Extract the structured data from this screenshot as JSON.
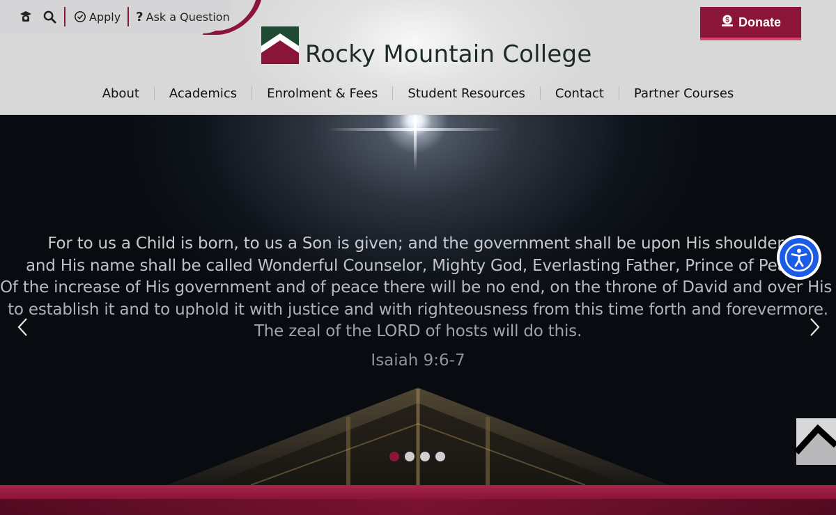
{
  "header": {
    "utility": {
      "apply_label": "Apply",
      "ask_label": "Ask a Question"
    },
    "donate_label": "Donate",
    "logo_text": "Rocky Mountain College"
  },
  "nav": {
    "items": [
      {
        "label": "About"
      },
      {
        "label": "Academics"
      },
      {
        "label": "Enrolment & Fees"
      },
      {
        "label": "Student Resources"
      },
      {
        "label": "Contact"
      },
      {
        "label": "Partner Courses"
      }
    ]
  },
  "hero": {
    "verse_lines": [
      "For to us a Child is born, to us a Son is given; and the government shall be upon His shoulder,",
      "and His name shall be called Wonderful Counselor, Mighty God, Everlasting Father, Prince of Peace.",
      "Of the increase of His government and of peace there will be no end, on the throne of David and over His kingdom,",
      "to establish it and to uphold it with justice and with righteousness from this time forth and forevermore.",
      "The zeal of the LORD of hosts will do this."
    ],
    "citation": "Isaiah 9:6-7",
    "slides_total": 4,
    "active_slide": 1
  },
  "colors": {
    "brand_maroon": "#8a1538",
    "brand_green": "#1f4a33",
    "accessibility_blue": "#1b5ce6"
  },
  "icons": [
    "graduate-icon",
    "search-icon",
    "check-circle-icon",
    "question-icon",
    "donate-hand-icon",
    "chevron-left-icon",
    "chevron-right-icon",
    "accessibility-icon",
    "scroll-top-icon"
  ]
}
